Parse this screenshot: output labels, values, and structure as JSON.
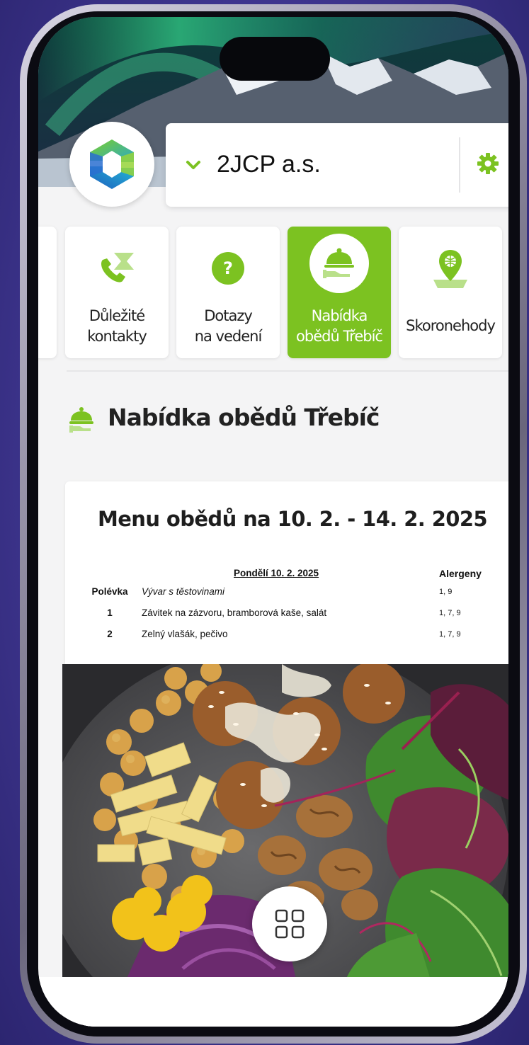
{
  "header": {
    "company_name": "2JCP a.s.",
    "company_selector_icon": "chevron-down-icon",
    "settings_icon": "gear-icon",
    "logo": "company-logo"
  },
  "tiles": [
    {
      "label_line1": "Důležité",
      "label_line2": "kontakty",
      "icon": "phone-contact-icon",
      "active": false
    },
    {
      "label_line1": "Dotazy",
      "label_line2": "na vedení",
      "icon": "question-icon",
      "active": false
    },
    {
      "label_line1": "Nabídka",
      "label_line2": "obědů Třebíč",
      "icon": "food-cloche-icon",
      "active": true
    },
    {
      "label_line1": "Skoronehody",
      "label_line2": "",
      "icon": "location-pin-icon",
      "active": false
    }
  ],
  "section": {
    "title": "Nabídka obědů Třebíč",
    "icon": "food-cloche-icon"
  },
  "menu": {
    "title": "Menu obědů na 10. 2. - 14. 2. 2025",
    "day_header": "Pondělí 10. 2. 2025",
    "allergens_header": "Alergeny",
    "rows": [
      {
        "label": "Polévka",
        "meal": "Vývar s těstovinami",
        "allergens": "1, 9"
      },
      {
        "label": "1",
        "meal": "Závitek na zázvoru, bramborová kaše, salát",
        "allergens": "1, 7, 9"
      },
      {
        "label": "2",
        "meal": "Zelný vlašák, pečivo",
        "allergens": "1, 7, 9"
      }
    ]
  },
  "fab": {
    "icon": "grid-menu-icon"
  },
  "colors": {
    "accent": "#7cc221",
    "background": "#f4f4f5",
    "text": "#222222"
  }
}
